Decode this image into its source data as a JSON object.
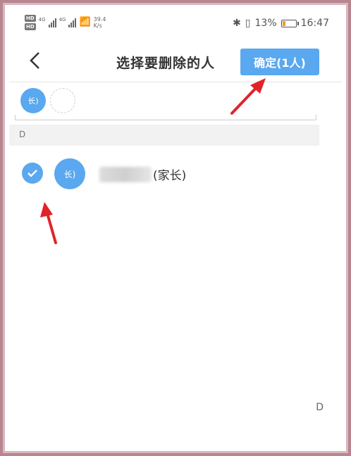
{
  "status_bar": {
    "hd_top": "HD",
    "hd_bottom": "HD",
    "net_1": "4G",
    "net_2": "4G",
    "speed_value": "39.4",
    "speed_unit": "K/s",
    "battery": "13%",
    "time": "16:47"
  },
  "header": {
    "title": "选择要删除的人",
    "confirm_label": "确定(1人)"
  },
  "selected": {
    "chip_text": "长)"
  },
  "section": {
    "letter": "D"
  },
  "contacts": [
    {
      "avatar_text": "长)",
      "name_suffix": "(家长)",
      "checked": true
    }
  ],
  "index_bar": {
    "letter": "D"
  },
  "colors": {
    "accent": "#5aa8ef",
    "arrow": "#e0242a"
  },
  "icons": {
    "back": "chevron-left-icon",
    "check": "check-icon",
    "battery": "battery-icon",
    "bluetooth": "bluetooth-icon"
  }
}
